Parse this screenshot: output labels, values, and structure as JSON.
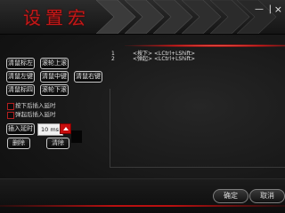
{
  "window": {
    "title": "设置宏",
    "minimize_glyph": "—",
    "maximize_glyph": "|",
    "close_glyph": "×"
  },
  "buttons": {
    "mouse_left": "清鼠标左",
    "wheel_up": "滚轮上滚",
    "mouse_left2": "清鼠左键",
    "mouse_middle": "清鼠中键",
    "mouse_right": "清鼠右键",
    "mouse_4": "清鼠标四",
    "wheel_down": "滚轮下滚"
  },
  "options": {
    "insert_delay_on_press": "按下后插入延时",
    "insert_delay_on_release": "弹起后插入延时"
  },
  "delay": {
    "button_label": "插入延时",
    "value": "10 ms"
  },
  "actions": {
    "delete": "删除",
    "clear": "清除"
  },
  "macro_list": [
    {
      "num": "1",
      "action": "<按下>",
      "key": "<LCtrl+LShift>"
    },
    {
      "num": "2",
      "action": "<弹起>",
      "key": "<LCtrl+LShift>"
    }
  ],
  "footer": {
    "ok": "确定",
    "cancel": "取消"
  },
  "colors": {
    "accent": "#c41818",
    "background": "#161616"
  }
}
